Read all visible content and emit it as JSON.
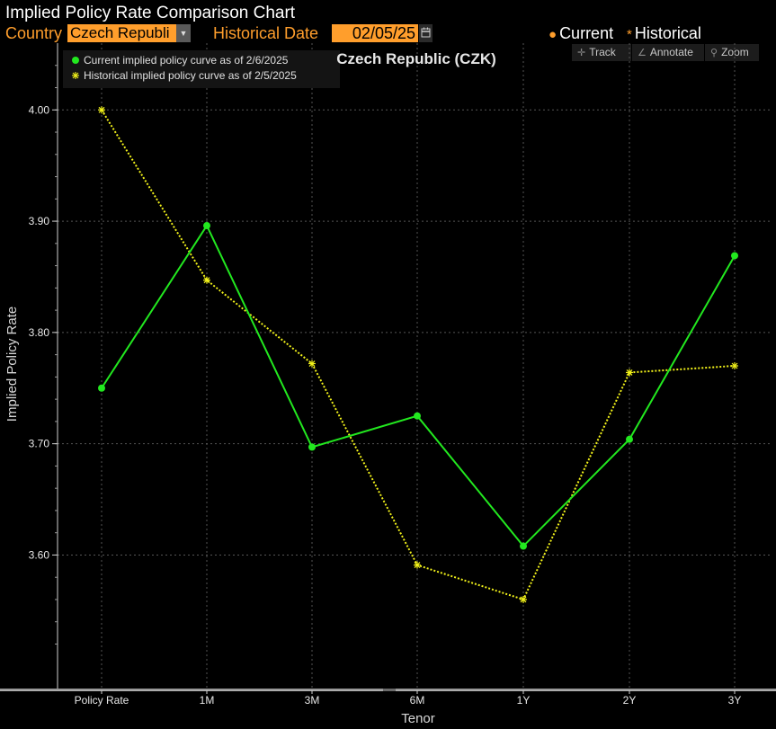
{
  "app": {
    "title": "Implied Policy Rate Comparison Chart"
  },
  "toolbar": {
    "country_label": "Country",
    "country_value": "Czech Republi",
    "historical_date_label": "Historical Date",
    "historical_date_value": "02/05/25"
  },
  "top_legend": {
    "current": "Current",
    "historical": "Historical"
  },
  "chart_tools": {
    "track": "Track",
    "annotate": "Annotate",
    "zoom": "Zoom"
  },
  "icons": [
    "dropdown-arrow-icon",
    "calendar-icon",
    "crosshair-icon",
    "pencil-icon",
    "magnifier-icon"
  ],
  "colors": {
    "accent": "#ff9e2c",
    "current": "#22e81f",
    "historical": "#f2f21a",
    "grid": "#555555"
  },
  "chart_data": {
    "type": "line",
    "title": "Czech Republic (CZK)",
    "xlabel": "Tenor",
    "ylabel": "Implied Policy Rate",
    "categories": [
      "Policy Rate",
      "1M",
      "3M",
      "6M",
      "1Y",
      "2Y",
      "3Y"
    ],
    "ylim": [
      3.48,
      4.06
    ],
    "yticks": [
      "4.00",
      "3.90",
      "3.80",
      "3.70",
      "3.60"
    ],
    "grid": true,
    "legend_position": "top-left",
    "series": [
      {
        "name": "Current implied policy curve as of 2/6/2025",
        "style": "solid",
        "marker": "dot",
        "color": "#22e81f",
        "values": [
          3.75,
          3.896,
          3.697,
          3.725,
          3.608,
          3.704,
          3.869
        ]
      },
      {
        "name": "Historical implied policy curve as of 2/5/2025",
        "style": "dotted",
        "marker": "asterisk",
        "color": "#f2f21a",
        "values": [
          4.0,
          3.847,
          3.772,
          3.591,
          3.56,
          3.764,
          3.77
        ]
      }
    ]
  }
}
